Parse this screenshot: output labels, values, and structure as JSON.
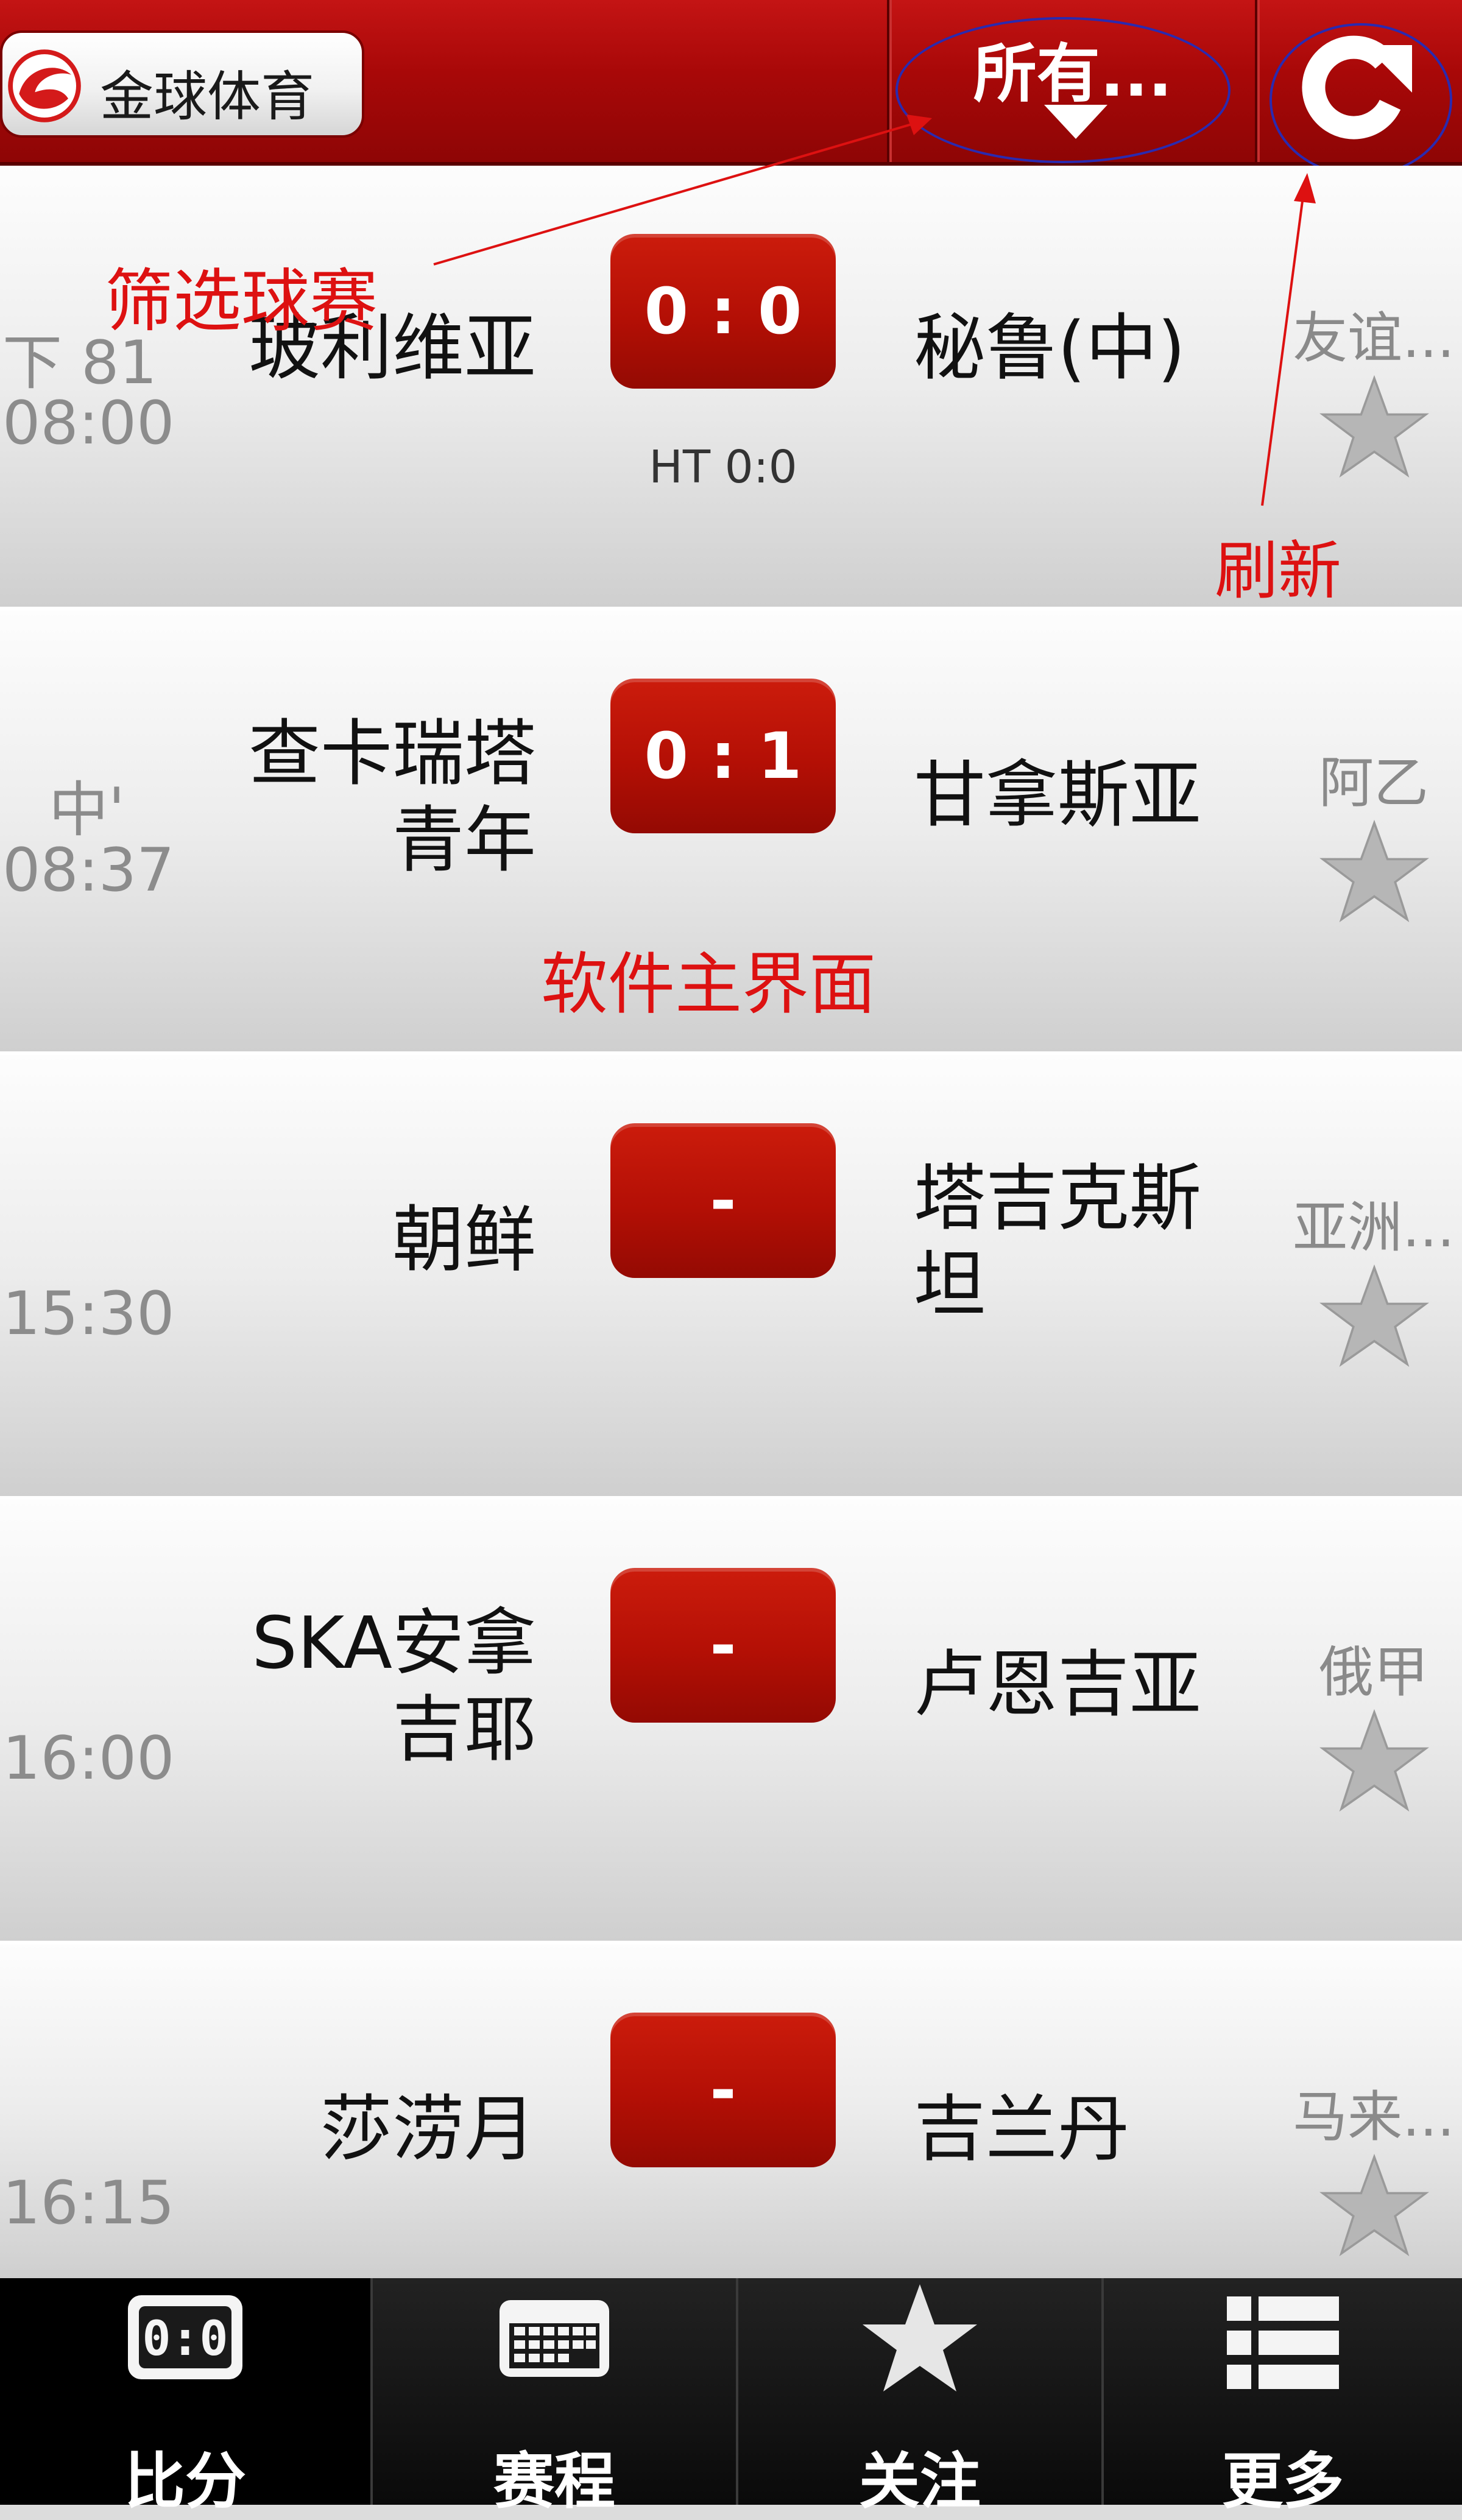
{
  "header": {
    "app_name": "金球体育",
    "filter_label": "所有...",
    "icons": {
      "logo": "app-logo-icon",
      "filter": "dropdown-arrow-icon",
      "refresh": "refresh-icon"
    }
  },
  "colors": {
    "brand_red": "#a80808",
    "annotation_red": "#dd1111",
    "annotation_blue": "#2a2ab0"
  },
  "matches": [
    {
      "time_top": "下 81",
      "time_bottom": "08:00",
      "home": "玻利维亚",
      "away": "秘鲁(中)",
      "score": "0 : 0",
      "halftime": "HT 0:0",
      "league": "友谊...",
      "favorite_icon": "star-icon"
    },
    {
      "time_top": "中'",
      "time_bottom": "08:37",
      "home": "查卡瑞塔青年",
      "away": "甘拿斯亚",
      "score": "0 : 1",
      "halftime": "",
      "league": "阿乙",
      "favorite_icon": "star-icon"
    },
    {
      "time_top": "",
      "time_bottom": "15:30",
      "home": "朝鲜",
      "away": "塔吉克斯坦",
      "score": "-",
      "halftime": "",
      "league": "亚洲...",
      "favorite_icon": "star-icon"
    },
    {
      "time_top": "",
      "time_bottom": "16:00",
      "home": "SKA安拿吉耶",
      "away": "卢恩吉亚",
      "score": "-",
      "halftime": "",
      "league": "俄甲",
      "favorite_icon": "star-icon"
    },
    {
      "time_top": "",
      "time_bottom": "16:15",
      "home": "莎涝月",
      "away": "吉兰丹",
      "score": "-",
      "halftime": "",
      "league": "马来...",
      "favorite_icon": "star-icon"
    }
  ],
  "annotations": {
    "filter": "筛选球赛",
    "refresh": "刷新",
    "main": "软件主界面"
  },
  "bottom_nav": [
    {
      "label": "比分",
      "icon": "scoreboard-icon",
      "active": true
    },
    {
      "label": "赛程",
      "icon": "calendar-icon",
      "active": false
    },
    {
      "label": "关注",
      "icon": "star-icon",
      "active": false
    },
    {
      "label": "更多",
      "icon": "list-icon",
      "active": false
    }
  ]
}
